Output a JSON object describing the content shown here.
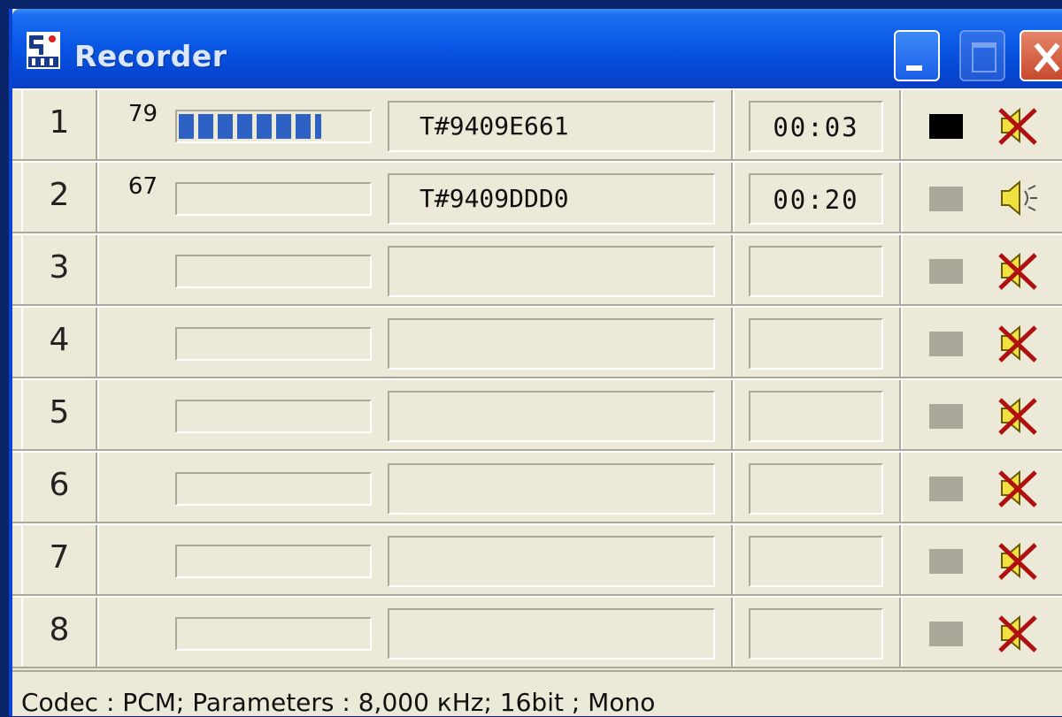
{
  "window": {
    "title": "Recorder"
  },
  "icons": {
    "app": "recorder-app-icon",
    "minimize": "minimize-icon",
    "maximize": "maximize-icon",
    "close": "close-icon",
    "speaker_on": "speaker-icon",
    "speaker_muted": "speaker-muted-icon"
  },
  "colors": {
    "meter": "#2d62c4",
    "titlebar": "#0a58e6",
    "led_active": "#000000",
    "led_idle": "#aca899"
  },
  "channels": [
    {
      "number": "1",
      "level_label": "79",
      "level_fraction": 0.74,
      "call_id": "T#9409E661",
      "time": "00:03",
      "led_active": true,
      "speaker_muted": true
    },
    {
      "number": "2",
      "level_label": "67",
      "level_fraction": 0.0,
      "call_id": "T#9409DDD0",
      "time": "00:20",
      "led_active": false,
      "speaker_muted": false
    },
    {
      "number": "3",
      "level_label": "",
      "level_fraction": 0.0,
      "call_id": "",
      "time": "",
      "led_active": false,
      "speaker_muted": true
    },
    {
      "number": "4",
      "level_label": "",
      "level_fraction": 0.0,
      "call_id": "",
      "time": "",
      "led_active": false,
      "speaker_muted": true
    },
    {
      "number": "5",
      "level_label": "",
      "level_fraction": 0.0,
      "call_id": "",
      "time": "",
      "led_active": false,
      "speaker_muted": true
    },
    {
      "number": "6",
      "level_label": "",
      "level_fraction": 0.0,
      "call_id": "",
      "time": "",
      "led_active": false,
      "speaker_muted": true
    },
    {
      "number": "7",
      "level_label": "",
      "level_fraction": 0.0,
      "call_id": "",
      "time": "",
      "led_active": false,
      "speaker_muted": true
    },
    {
      "number": "8",
      "level_label": "",
      "level_fraction": 0.0,
      "call_id": "",
      "time": "",
      "led_active": false,
      "speaker_muted": true
    }
  ],
  "status": {
    "text": "Codec : PCM; Parameters : 8,000 кHz; 16bit ; Mono"
  }
}
